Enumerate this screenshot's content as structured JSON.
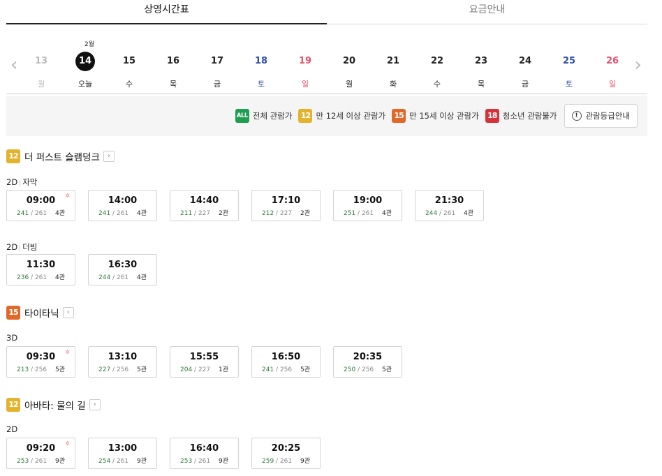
{
  "tabs": [
    {
      "label": "상영시간표",
      "active": true
    },
    {
      "label": "요금안내",
      "active": false
    }
  ],
  "datestrip": {
    "month": "2월",
    "days": [
      {
        "num": "13",
        "weekday": "월",
        "state": "past"
      },
      {
        "num": "14",
        "weekday": "오늘",
        "state": "today"
      },
      {
        "num": "15",
        "weekday": "수",
        "state": ""
      },
      {
        "num": "16",
        "weekday": "목",
        "state": ""
      },
      {
        "num": "17",
        "weekday": "금",
        "state": ""
      },
      {
        "num": "18",
        "weekday": "토",
        "state": "sat"
      },
      {
        "num": "19",
        "weekday": "일",
        "state": "sun"
      },
      {
        "num": "20",
        "weekday": "월",
        "state": ""
      },
      {
        "num": "21",
        "weekday": "화",
        "state": ""
      },
      {
        "num": "22",
        "weekday": "수",
        "state": ""
      },
      {
        "num": "23",
        "weekday": "목",
        "state": ""
      },
      {
        "num": "24",
        "weekday": "금",
        "state": ""
      },
      {
        "num": "25",
        "weekday": "토",
        "state": "sat"
      },
      {
        "num": "26",
        "weekday": "일",
        "state": "sun"
      }
    ]
  },
  "legend": {
    "items": [
      {
        "badge": "ALL",
        "cls": "b-all",
        "label": "전체 관람가"
      },
      {
        "badge": "12",
        "cls": "b-12",
        "label": "만 12세 이상 관람가"
      },
      {
        "badge": "15",
        "cls": "b-15",
        "label": "만 15세 이상 관람가"
      },
      {
        "badge": "18",
        "cls": "b-18",
        "label": "청소년 관람불가"
      }
    ],
    "guide_label": "관람등급안내",
    "guide_icon": "!"
  },
  "movies": [
    {
      "rating": "12",
      "rating_cls": "b-12",
      "title": "더 퍼스트 슬램덩크",
      "formats": [
        {
          "format": "2D",
          "sub": "자막",
          "shows": [
            {
              "time": "09:00",
              "avail": "241",
              "total": "261",
              "hall": "4관",
              "morning": true
            },
            {
              "time": "14:00",
              "avail": "241",
              "total": "261",
              "hall": "4관"
            },
            {
              "time": "14:40",
              "avail": "211",
              "total": "227",
              "hall": "2관"
            },
            {
              "time": "17:10",
              "avail": "212",
              "total": "227",
              "hall": "2관"
            },
            {
              "time": "19:00",
              "avail": "251",
              "total": "261",
              "hall": "4관"
            },
            {
              "time": "21:30",
              "avail": "244",
              "total": "261",
              "hall": "4관"
            }
          ]
        },
        {
          "format": "2D",
          "sub": "더빙",
          "shows": [
            {
              "time": "11:30",
              "avail": "236",
              "total": "261",
              "hall": "4관"
            },
            {
              "time": "16:30",
              "avail": "244",
              "total": "261",
              "hall": "4관"
            }
          ]
        }
      ]
    },
    {
      "rating": "15",
      "rating_cls": "b-15",
      "title": "타이타닉",
      "formats": [
        {
          "format": "3D",
          "sub": "",
          "shows": [
            {
              "time": "09:30",
              "avail": "213",
              "total": "256",
              "hall": "5관",
              "morning": true
            },
            {
              "time": "13:10",
              "avail": "227",
              "total": "256",
              "hall": "5관"
            },
            {
              "time": "15:55",
              "avail": "204",
              "total": "227",
              "hall": "1관"
            },
            {
              "time": "16:50",
              "avail": "241",
              "total": "256",
              "hall": "5관"
            },
            {
              "time": "20:35",
              "avail": "250",
              "total": "256",
              "hall": "5관"
            }
          ]
        }
      ]
    },
    {
      "rating": "12",
      "rating_cls": "b-12",
      "title": "아바타: 물의 길",
      "formats": [
        {
          "format": "2D",
          "sub": "",
          "shows": [
            {
              "time": "09:20",
              "avail": "253",
              "total": "261",
              "hall": "9관",
              "morning": true
            },
            {
              "time": "13:00",
              "avail": "254",
              "total": "261",
              "hall": "9관"
            },
            {
              "time": "16:40",
              "avail": "253",
              "total": "261",
              "hall": "9관"
            },
            {
              "time": "20:25",
              "avail": "259",
              "total": "261",
              "hall": "9관"
            }
          ]
        }
      ]
    }
  ],
  "icons": {
    "prev": "chevron-left-icon",
    "next": "chevron-right-icon",
    "morning": "sun-icon",
    "movie_link": "chevron-right-icon"
  }
}
